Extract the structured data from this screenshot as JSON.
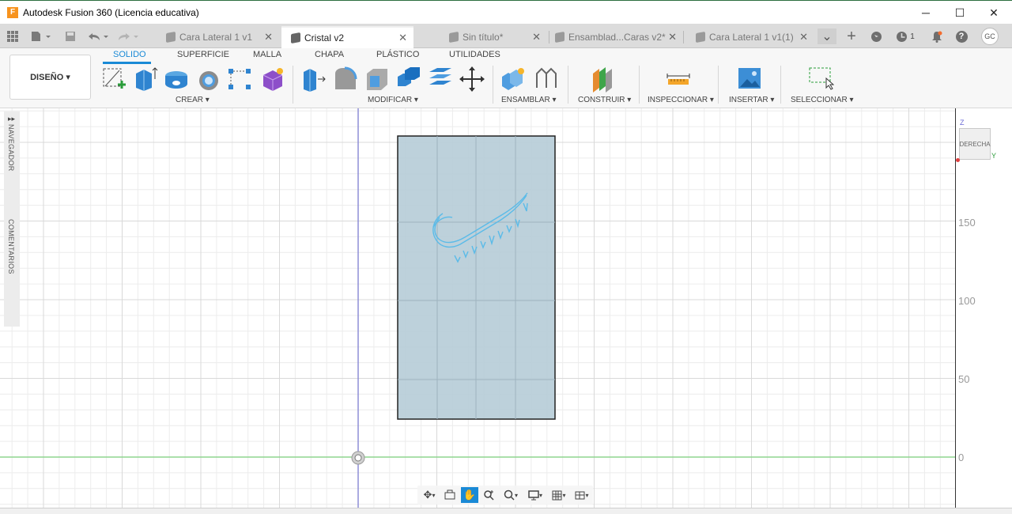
{
  "window": {
    "title": "Autodesk Fusion 360 (Licencia educativa)",
    "logo_letter": "F",
    "minimize": "─",
    "maximize": "☐",
    "close": "✕"
  },
  "quick_access": {
    "icons": [
      "grid-icon",
      "file-icon",
      "save-icon",
      "undo-icon",
      "redo-icon"
    ]
  },
  "tabs": [
    {
      "label": "Cara Lateral 1 v1",
      "active": false
    },
    {
      "label": "Cristal v2",
      "active": true
    },
    {
      "label": "Sin título*",
      "active": false
    },
    {
      "label": "Ensamblad...Caras v2*",
      "active": false
    },
    {
      "label": "Cara Lateral 1 v1(1)",
      "active": false
    }
  ],
  "tab_close": "✕",
  "right_icons": {
    "more": "⌄",
    "add": "+",
    "jobs_count": "1",
    "avatar_initials": "GC",
    "help": "?"
  },
  "ribbon": {
    "workspace": "DISEÑO ▾",
    "tabs": [
      "SOLIDO",
      "SUPERFICIE",
      "MALLA",
      "CHAPA",
      "PLÁSTICO",
      "UTILIDADES"
    ],
    "active_tab": "SOLIDO",
    "groups": [
      "CREAR ▾",
      "MODIFICAR ▾",
      "ENSAMBLAR ▾",
      "CONSTRUIR ▾",
      "INSPECCIONAR ▾",
      "INSERTAR ▾",
      "SELECCIONAR ▾"
    ]
  },
  "side_panel": {
    "navigator": "NAVEGADOR",
    "comments": "COMENTARIOS"
  },
  "viewcube": {
    "face": "DERECHA",
    "z": "Z",
    "y": "Y"
  },
  "axis_ticks": [
    "150",
    "100",
    "50",
    "0"
  ],
  "colors": {
    "accent": "#1a8ad6",
    "body_fill": "#b6ccd7",
    "sketch": "#5bbbe8",
    "axis_green": "#8fd68f",
    "axis_blue": "#8e8ed6"
  }
}
